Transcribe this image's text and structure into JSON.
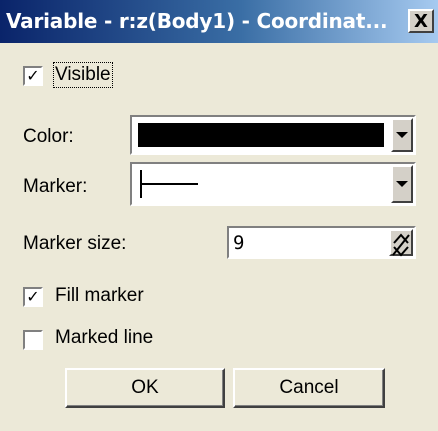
{
  "window": {
    "title": "Variable - r:z(Body1) - Coordinat...",
    "close_label": "X"
  },
  "visible": {
    "label": "Visible",
    "checked": true
  },
  "color": {
    "label": "Color:",
    "value": "#000000"
  },
  "marker": {
    "label": "Marker:",
    "style": "horizontal-line"
  },
  "marker_size": {
    "label": "Marker size:",
    "value": "9"
  },
  "fill_marker": {
    "label": "Fill marker",
    "checked": true
  },
  "marked_line": {
    "label": "Marked line",
    "checked": false
  },
  "buttons": {
    "ok": "OK",
    "cancel": "Cancel"
  },
  "icons": {
    "close": "close-icon",
    "dropdown": "chevron-down-icon",
    "spin": "spinner-arrows-icon"
  }
}
